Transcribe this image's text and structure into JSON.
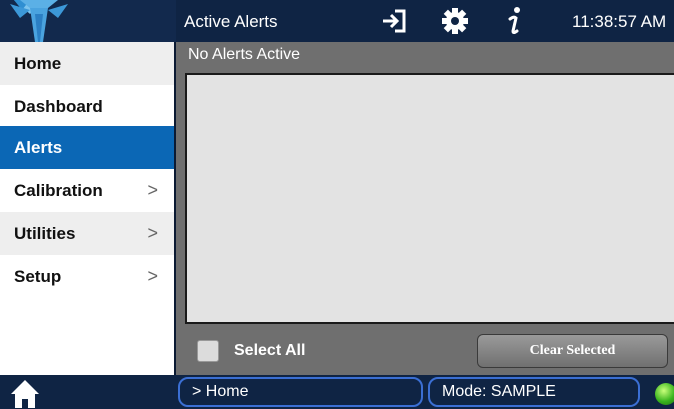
{
  "header": {
    "title": "Active Alerts",
    "time": "11:38:57 AM",
    "icons": [
      "logo-icon",
      "logout-icon",
      "gear-icon",
      "info-icon"
    ]
  },
  "sidebar": {
    "items": [
      {
        "label": "Home",
        "has_submenu": false
      },
      {
        "label": "Dashboard",
        "has_submenu": false
      },
      {
        "label": "Alerts",
        "has_submenu": false,
        "active": true
      },
      {
        "label": "Calibration",
        "has_submenu": true
      },
      {
        "label": "Utilities",
        "has_submenu": true
      },
      {
        "label": "Setup",
        "has_submenu": true
      }
    ],
    "chevron": ">"
  },
  "main": {
    "status_text": "No Alerts Active",
    "alerts": [],
    "select_all_label": "Select All",
    "select_all_checked": false,
    "clear_button_label": "Clear Selected"
  },
  "footer": {
    "path": "> Home",
    "mode": "Mode: SAMPLE",
    "status_led": "green"
  },
  "colors": {
    "header_bg": "#0f2444",
    "active_nav": "#0b67b5",
    "main_bg": "#6f6f6f",
    "list_bg": "#e3e3e3",
    "pill_border": "#3b6fd4",
    "logo": "#4aa3df"
  }
}
